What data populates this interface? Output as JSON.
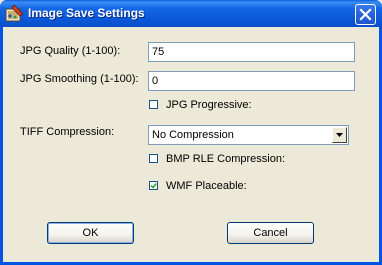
{
  "window": {
    "title": "Image Save Settings",
    "icons": {
      "app": "palette-icon",
      "close": "close-icon"
    }
  },
  "form": {
    "jpg_quality": {
      "label": "JPG Quality (1-100):",
      "value": "75"
    },
    "jpg_smoothing": {
      "label": "JPG Smoothing (1-100):",
      "value": "0"
    },
    "jpg_progressive": {
      "label": "JPG Progressive:",
      "checked": false
    },
    "tiff_compression": {
      "label": "TIFF Compression:",
      "selected": "No Compression"
    },
    "bmp_rle": {
      "label": "BMP RLE Compression:",
      "checked": false
    },
    "wmf_placeable": {
      "label": "WMF Placeable:",
      "checked": true
    }
  },
  "buttons": {
    "ok": "OK",
    "cancel": "Cancel"
  },
  "colors": {
    "titlebar": "#0054e3",
    "dialog_bg": "#ece9d8",
    "input_border": "#7f9db9"
  }
}
